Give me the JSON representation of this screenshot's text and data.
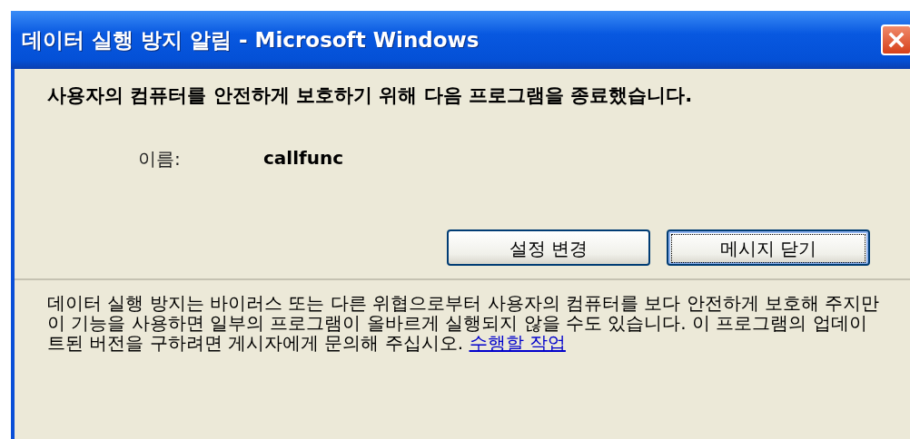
{
  "window": {
    "title": "데이터 실행 방지 알림 - Microsoft Windows"
  },
  "message": "사용자의 컴퓨터를 안전하게 보호하기 위해 다음 프로그램을 종료했습니다.",
  "program": {
    "label": "이름:",
    "value": "callfunc"
  },
  "buttons": [
    {
      "label": "설정 변경",
      "focused": false
    },
    {
      "label": "메시지 닫기",
      "focused": true
    }
  ],
  "details": {
    "text": "데이터 실행 방지는 바이러스 또는 다른 위협으로부터 사용자의 컴퓨터를 보다 안전하게 보호해 주지만 이 기능을 사용하면 일부의 프로그램이 올바르게 실행되지 않을 수도 있습니다. 이 프로그램의 업데이트된 버전을 구하려면 게시자에게 문의해 주십시오.",
    "link": "수행할 작업"
  }
}
